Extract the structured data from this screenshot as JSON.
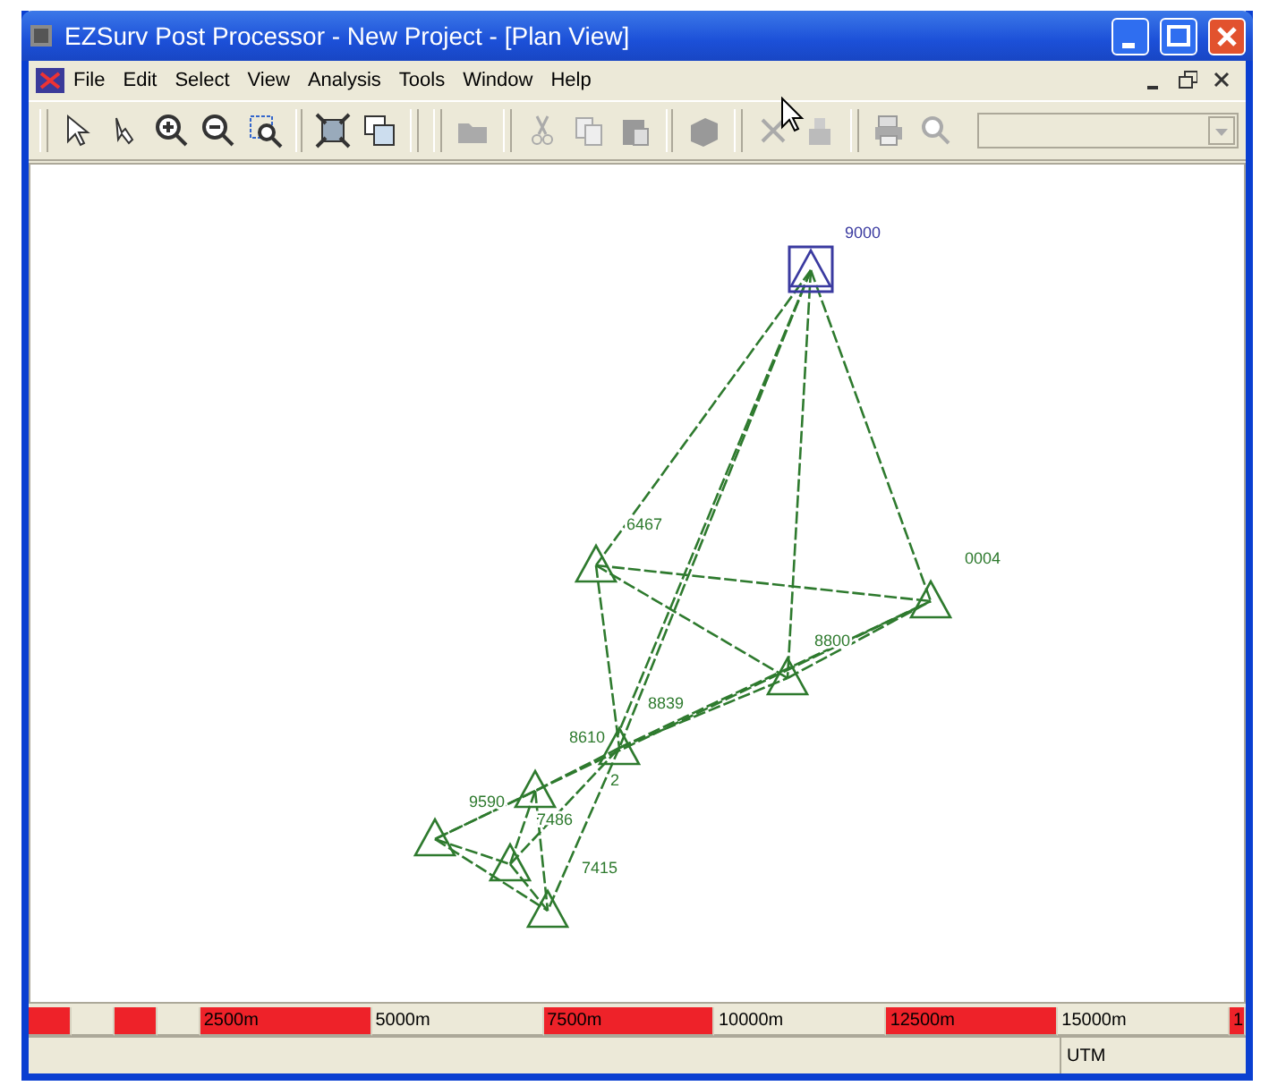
{
  "window": {
    "title": "EZSurv Post Processor - New Project - [Plan View]"
  },
  "menu": [
    "File",
    "Edit",
    "Select",
    "View",
    "Analysis",
    "Tools",
    "Window",
    "Help"
  ],
  "toolbar": {
    "combo": {
      "disabled": true
    }
  },
  "stations": [
    {
      "label": "9000",
      "selected": true
    },
    {
      "label": "6467",
      "selected": false
    },
    {
      "label": "0004",
      "selected": false
    },
    {
      "label": "8800",
      "selected": false
    },
    {
      "label": "8839",
      "selected": false
    },
    {
      "label": "8610",
      "selected": false
    },
    {
      "label": "2",
      "selected": false
    },
    {
      "label": "9590",
      "selected": false
    },
    {
      "label": "7486",
      "selected": false
    },
    {
      "label": "7415",
      "selected": false
    }
  ],
  "scale_bar": [
    {
      "kind": "minor",
      "color": "#ee2229"
    },
    {
      "kind": "minor",
      "color": "#ece9d8"
    },
    {
      "kind": "minor",
      "color": "#ee2229"
    },
    {
      "kind": "minor",
      "color": "#ece9d8"
    },
    {
      "kind": "major",
      "color": "#ee2229",
      "label": "2500m"
    },
    {
      "kind": "major",
      "color": "#ece9d8",
      "label": "5000m"
    },
    {
      "kind": "major",
      "color": "#ee2229",
      "label": "7500m"
    },
    {
      "kind": "major",
      "color": "#ece9d8",
      "label": "10000m"
    },
    {
      "kind": "major",
      "color": "#ee2229",
      "label": "12500m"
    },
    {
      "kind": "major",
      "color": "#ece9d8",
      "label": "15000m"
    },
    {
      "kind": "cut",
      "color": "#ee2229",
      "label": "1"
    }
  ],
  "status_bar": {
    "coordinates": "UTM"
  }
}
